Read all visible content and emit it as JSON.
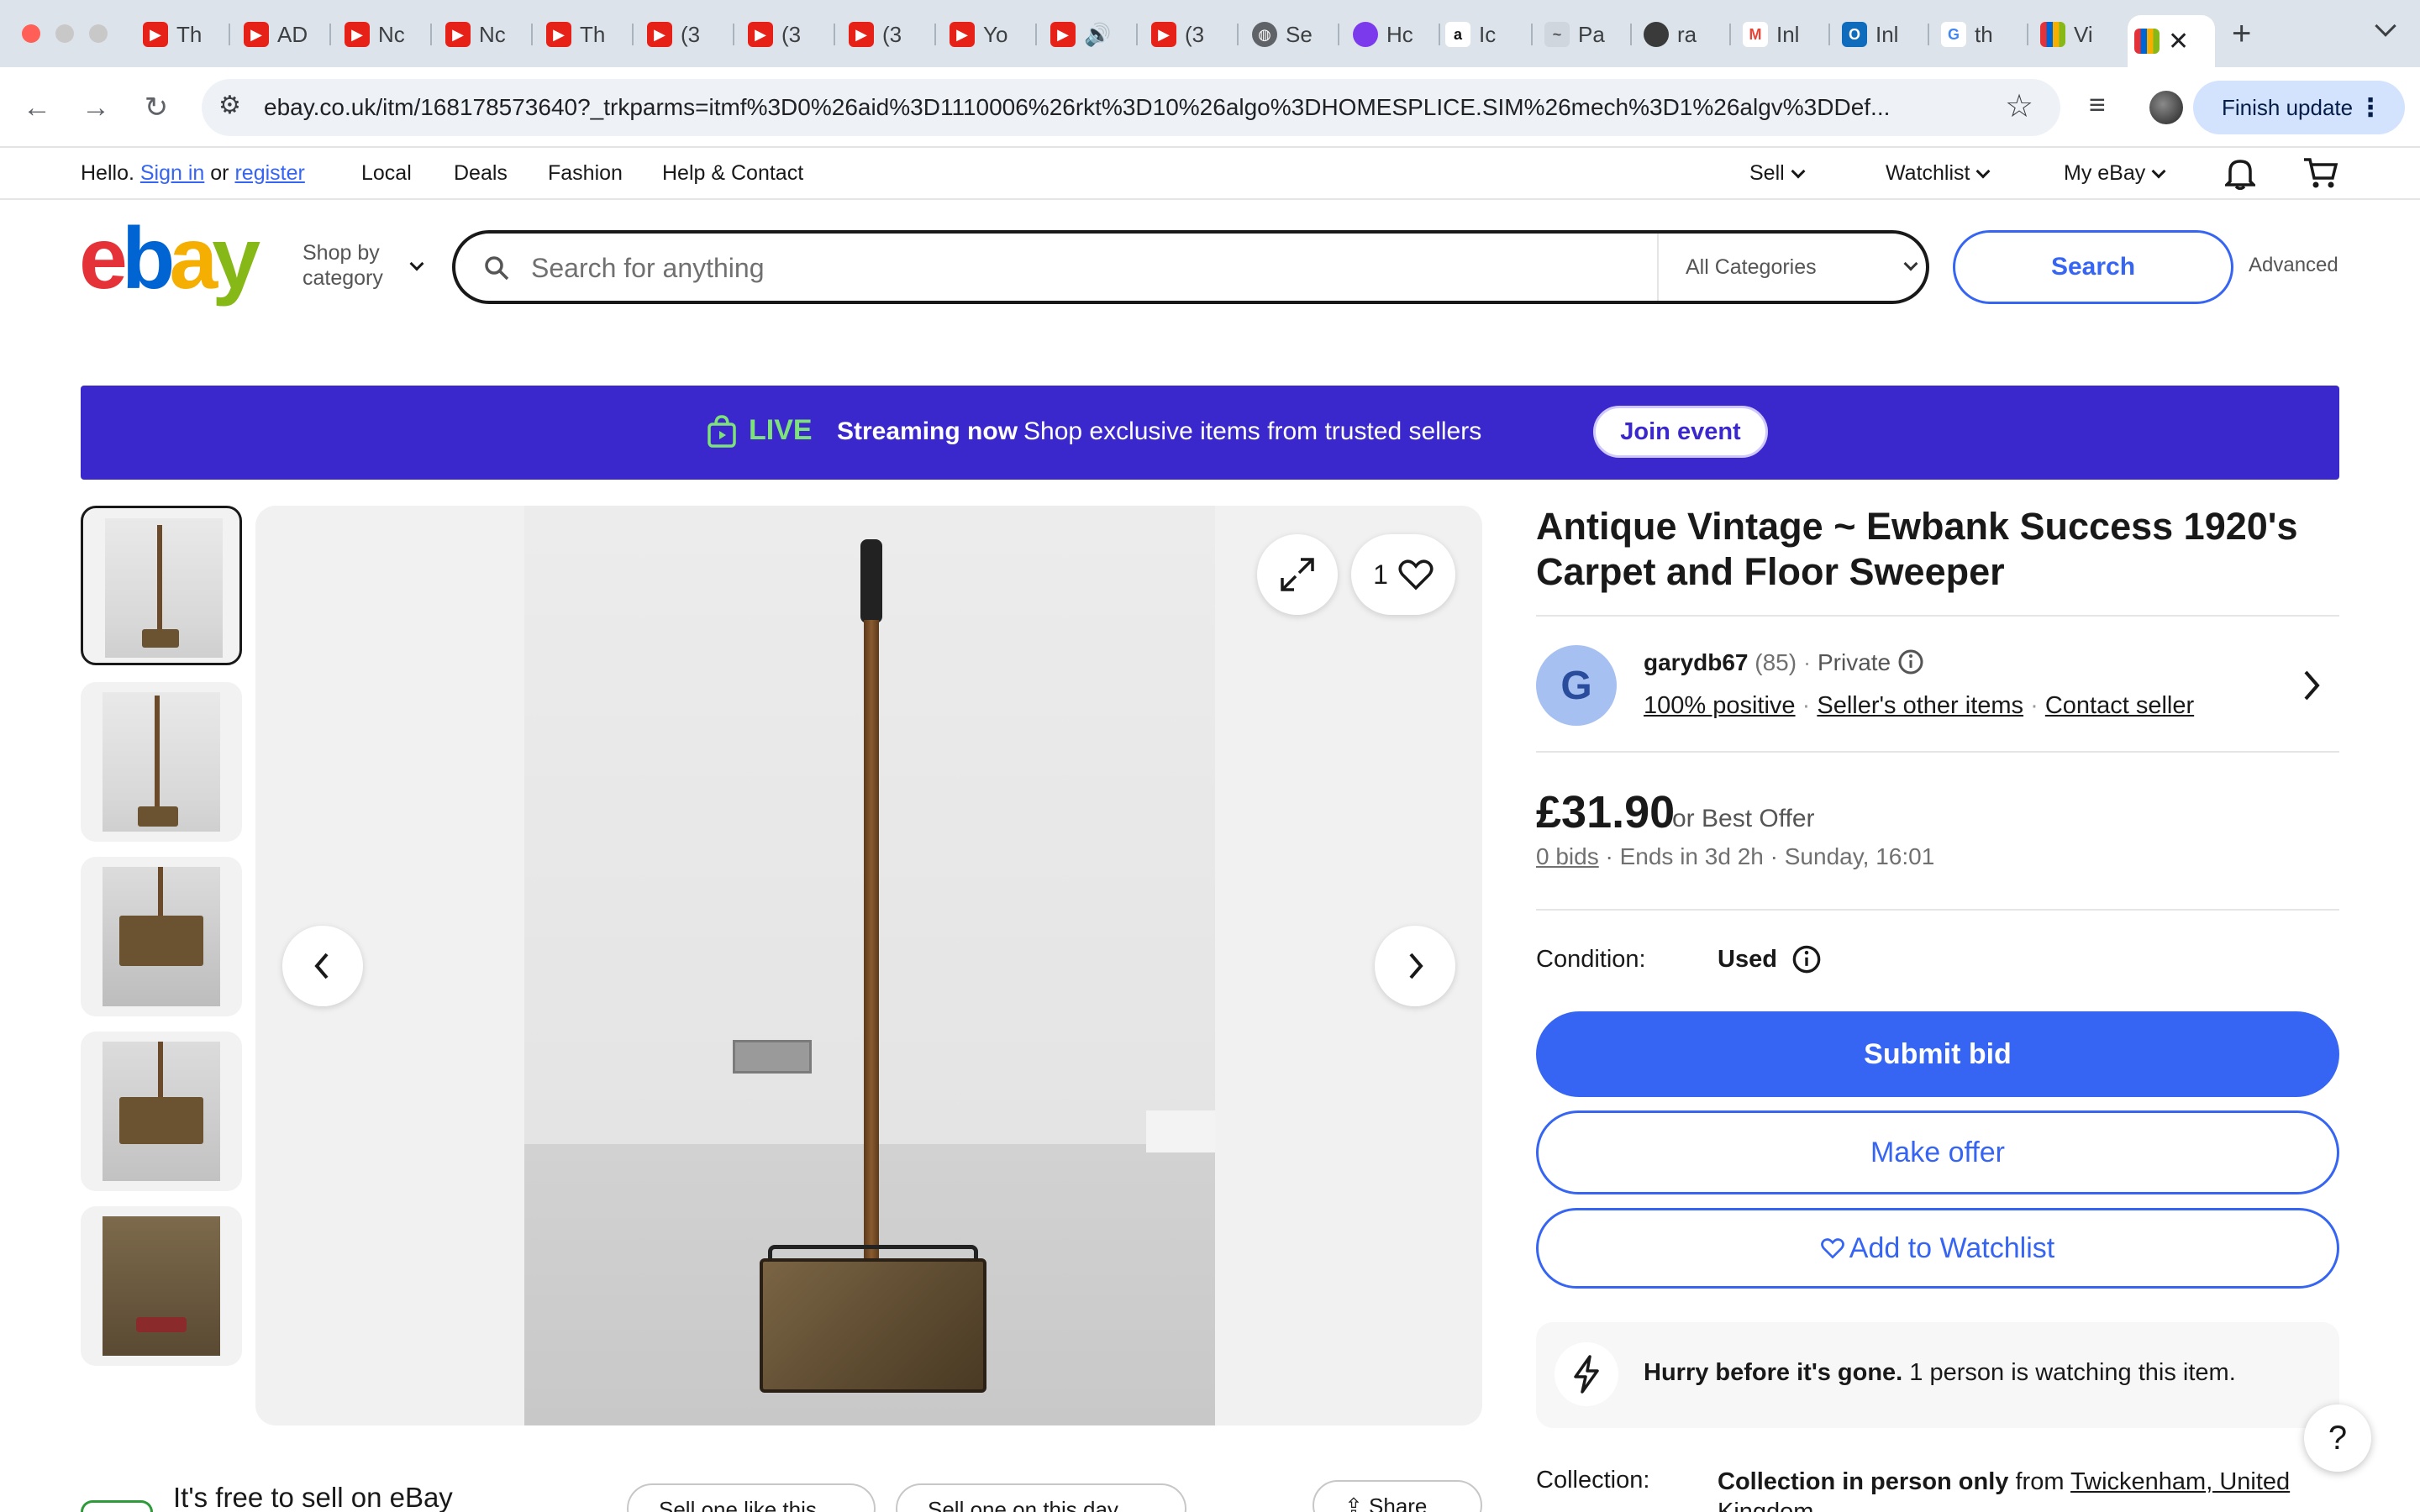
{
  "browser": {
    "tabs": [
      {
        "icon": "youtube-icon",
        "label": "Th"
      },
      {
        "icon": "youtube-icon",
        "label": "AD"
      },
      {
        "icon": "youtube-icon",
        "label": "Nc"
      },
      {
        "icon": "youtube-icon",
        "label": "Nc"
      },
      {
        "icon": "youtube-icon",
        "label": "Th"
      },
      {
        "icon": "youtube-icon",
        "label": "(3"
      },
      {
        "icon": "youtube-icon",
        "label": "(3"
      },
      {
        "icon": "youtube-icon",
        "label": "(3"
      },
      {
        "icon": "youtube-icon",
        "label": "Yo"
      },
      {
        "icon": "youtube-icon",
        "label": ""
      },
      {
        "icon": "youtube-icon",
        "label": "(3"
      },
      {
        "icon": "globe-icon",
        "label": "Se"
      },
      {
        "icon": "purple-circle-icon",
        "label": "Hc"
      },
      {
        "icon": "amazon-icon",
        "label": "Ic"
      },
      {
        "icon": "scribble-icon",
        "label": "Pa"
      },
      {
        "icon": "round-app-icon",
        "label": "ra"
      },
      {
        "icon": "gmail-icon",
        "label": "Inl"
      },
      {
        "icon": "outlook-icon",
        "label": "Inl"
      },
      {
        "icon": "google-icon",
        "label": "th"
      },
      {
        "icon": "ebay-tab-icon",
        "label": "Vi"
      },
      {
        "icon": "ebay-tab-icon",
        "label": ""
      }
    ],
    "url": "ebay.co.uk/itm/168178573640?_trkparms=itmf%3D0%26aid%3D1110006%26rkt%3D10%26algo%3DHOMESPLICE.SIM%26mech%3D1%26algv%3DDef...",
    "finish_update": "Finish update"
  },
  "topnav": {
    "hello": "Hello.",
    "sign_in": "Sign in",
    "or": "or",
    "register": "register",
    "links": [
      "Local",
      "Deals",
      "Fashion",
      "Help & Contact"
    ],
    "sell": "Sell",
    "watchlist": "Watchlist",
    "my_ebay": "My eBay"
  },
  "header": {
    "logo_letters": [
      "e",
      "b",
      "a",
      "y"
    ],
    "logo_colors": [
      "#e53238",
      "#0064d2",
      "#f5af02",
      "#86b817"
    ],
    "shop_by": "Shop by",
    "category": "category",
    "search_placeholder": "Search for anything",
    "all_categories": "All Categories",
    "search_button": "Search",
    "advanced": "Advanced"
  },
  "live_banner": {
    "live": "LIVE",
    "streaming": "Streaming now",
    "text": "Shop exclusive items from trusted sellers",
    "join": "Join event"
  },
  "gallery": {
    "watch_count": "1"
  },
  "listing": {
    "title": "Antique Vintage ~ Ewbank Success 1920's Carpet and Floor Sweeper",
    "seller": {
      "initial": "G",
      "name": "garydb67",
      "feedback": "(85)",
      "type": "Private",
      "positive": "100% positive",
      "other_items": "Seller's other items",
      "contact": "Contact seller"
    },
    "price": "£31.90",
    "best_offer": "or Best Offer",
    "bids": "0 bids",
    "ends": "Ends in 3d 2h",
    "end_time": "Sunday, 16:01",
    "condition_label": "Condition:",
    "condition_value": "Used",
    "submit_bid": "Submit bid",
    "make_offer": "Make offer",
    "add_watchlist": "Add to Watchlist",
    "hurry_bold": "Hurry before it's gone.",
    "hurry_text": "1 person is watching this item.",
    "collection_label": "Collection:",
    "collection_bold": "Collection in person only",
    "collection_from": "from",
    "collection_place": "Twickenham, United Kingdom"
  },
  "footer_strip": {
    "free_to_sell": "It's free to sell on eBay",
    "pill1": "Sell one like this",
    "pill2": "Sell one on this day",
    "share": "Share"
  },
  "help": "?"
}
